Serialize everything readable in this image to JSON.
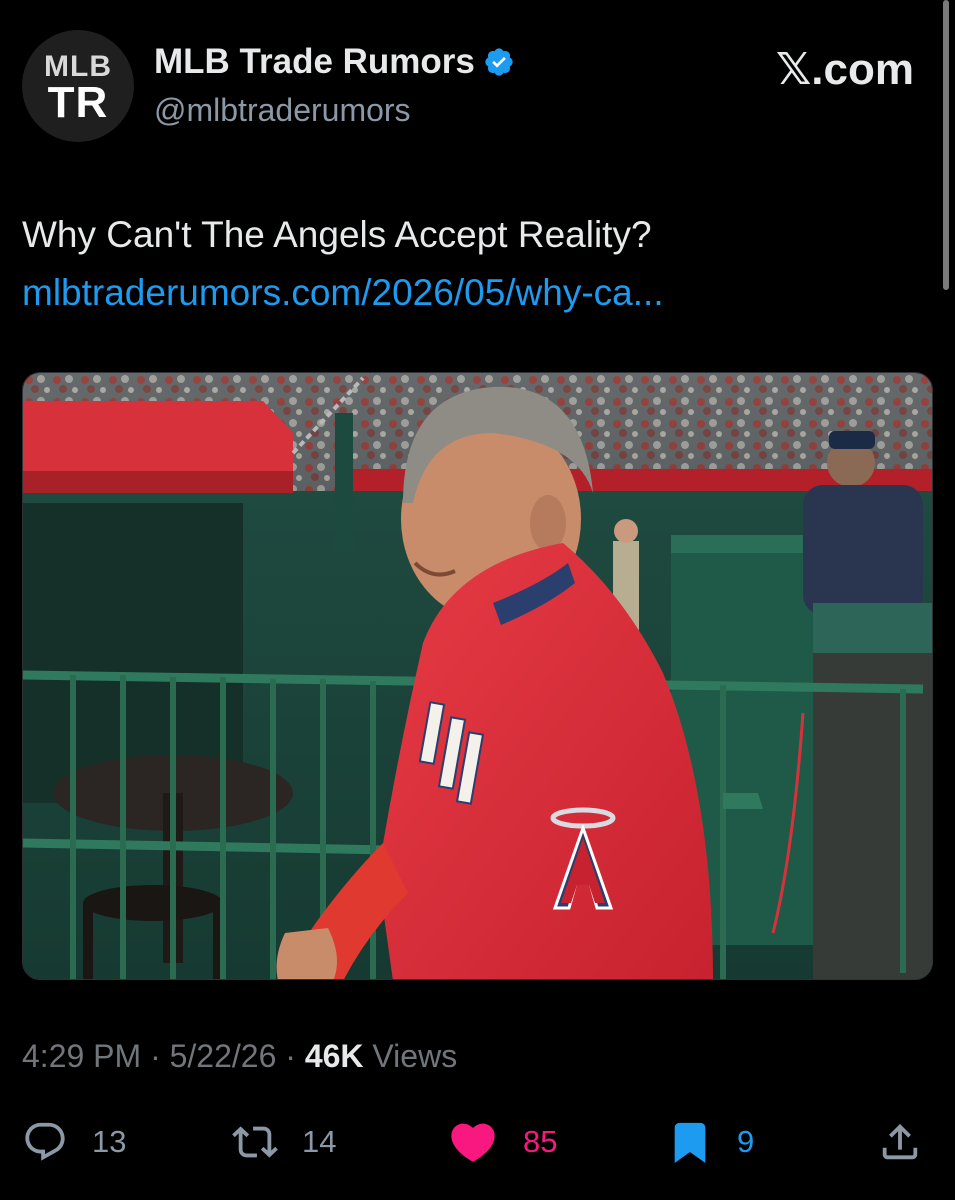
{
  "account": {
    "avatar_line1": "MLB",
    "avatar_line2": "TR",
    "display_name": "MLB Trade Rumors",
    "handle": "@mlbtraderumors",
    "verified": true
  },
  "brand": {
    "label": ".com",
    "glyph": "𝕏"
  },
  "tweet": {
    "text": "Why Can't The Angels Accept Reality?",
    "link": "mlbtraderumors.com/2026/05/why-ca..."
  },
  "media": {
    "alt_subject": "man-in-red-angels-jacket"
  },
  "meta": {
    "time": "4:29 PM",
    "separator1": " · ",
    "date": "5/22/26",
    "separator2": " · ",
    "views_count": "46K",
    "views_label": " Views"
  },
  "actions": {
    "replies": "13",
    "reposts": "14",
    "likes": "85",
    "bookmarks": "9"
  },
  "colors": {
    "background": "#000000",
    "link": "#1d9bf0",
    "like": "#f91880",
    "bookmark": "#1d9bf0",
    "muted": "#71767b"
  }
}
